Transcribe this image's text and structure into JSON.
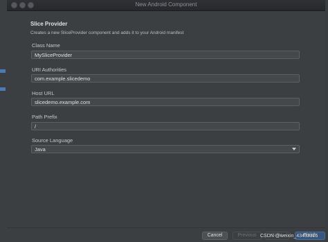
{
  "window": {
    "title": "New Android Component"
  },
  "header": {
    "title": "Slice Provider",
    "description": "Creates a new SliceProvider component and adds it to your Android manifest"
  },
  "fields": [
    {
      "label": "Class Name",
      "value": "MySliceProvider"
    },
    {
      "label": "URI Authorities",
      "value": "com.example.slicedemo"
    },
    {
      "label": "Host URL",
      "value": "slicedemo.example.com"
    },
    {
      "label": "Path Prefix",
      "value": "/"
    },
    {
      "label": "Source Language",
      "value": "Java",
      "type": "select"
    }
  ],
  "buttons": {
    "cancel": "Cancel",
    "previous": "Previous",
    "next": "Next",
    "finish": "Finish"
  },
  "watermark": "CSDN @weixin_43433316",
  "colors": {
    "accent": "#365880",
    "background": "#3c3f41",
    "field": "#45484a"
  }
}
